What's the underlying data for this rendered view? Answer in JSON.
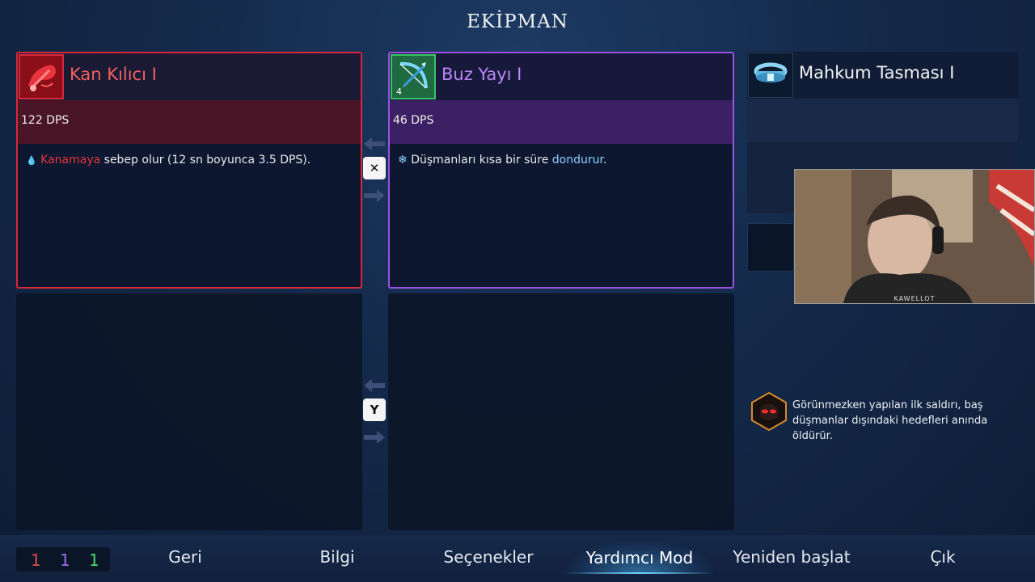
{
  "screen_title": "EKİPMAN",
  "equipment": {
    "primary_weapon": {
      "name": "Kan Kılıcı I",
      "dps": "122 DPS",
      "desc_keyword": "Kanamaya",
      "desc_rest": " sebep olur (12 sn boyunca 3.5 DPS).",
      "icon": "blood-sword-icon",
      "accent": "#d8283a"
    },
    "secondary_weapon": {
      "name": "Buz Yayı I",
      "dps": "46 DPS",
      "desc_prefix": "Düşmanları kısa bir süre ",
      "desc_keyword": "dondurur",
      "desc_suffix": ".",
      "icon": "ice-bow-icon",
      "icon_count": "4",
      "accent": "#9b52e0"
    },
    "amulet": {
      "name": "Mahkum Tasması I",
      "icon": "prisoner-collar-icon"
    }
  },
  "swap_keys": {
    "weapons": "✕",
    "skills": "Y"
  },
  "mutation": {
    "text": "Görünmezken yapılan ilk saldırı, baş düşmanlar dışındaki hedefleri anında öldürür.",
    "icon": "assassin-mutation-icon"
  },
  "webcam": {
    "label": "KAWELLOT"
  },
  "scroll_counts": {
    "brutality": "1",
    "tactics": "1",
    "survival": "1"
  },
  "menu": {
    "back": "Geri",
    "info": "Bilgi",
    "options": "Seçenekler",
    "assist_mode": "Yardımcı Mod",
    "restart": "Yeniden başlat",
    "quit": "Çık"
  },
  "colors": {
    "brutality": "#e04b4b",
    "tactics": "#a06ee6",
    "survival": "#4fd86a",
    "freeze_keyword": "#8fd0ff",
    "bleed_keyword": "#e8343c"
  }
}
